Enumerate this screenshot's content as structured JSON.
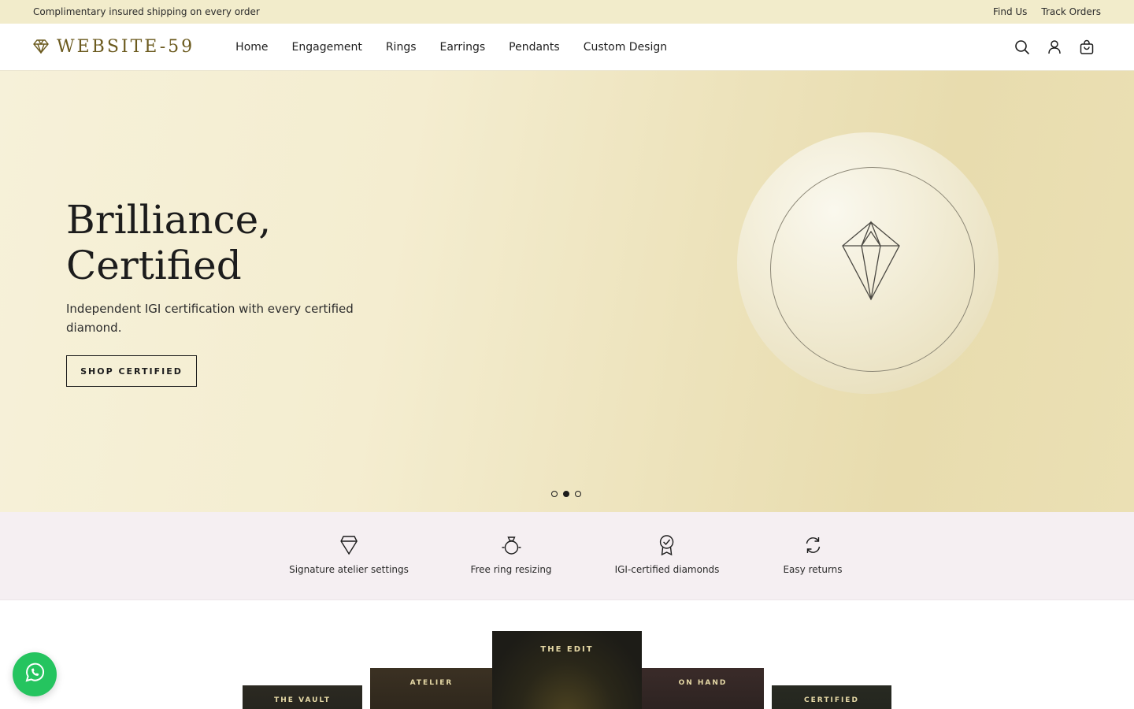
{
  "announcement": {
    "text": "Complimentary insured shipping on every order",
    "links": [
      "Find Us",
      "Track Orders"
    ]
  },
  "header": {
    "logo_text": "WEBSITE-59",
    "logo_icon": "diamond-icon",
    "nav": [
      "Home",
      "Engagement",
      "Rings",
      "Earrings",
      "Pendants",
      "Custom Design"
    ],
    "icons": [
      "search-icon",
      "account-icon",
      "cart-icon"
    ]
  },
  "hero": {
    "title_line1": "Brilliance,",
    "title_line2": "Certified",
    "subtitle": "Independent IGI certification with every certified diamond.",
    "button_label": "SHOP CERTIFIED",
    "slides_total": 3,
    "active_slide": 2
  },
  "features": [
    {
      "label": "Signature atelier settings",
      "icon": "diamond-outline-icon"
    },
    {
      "label": "Free ring resizing",
      "icon": "ring-icon"
    },
    {
      "label": "IGI-certified diamonds",
      "icon": "certified-badge-icon"
    },
    {
      "label": "Easy returns",
      "icon": "refresh-icon"
    }
  ],
  "collections": [
    "THE VAULT",
    "ATELIER",
    "THE EDIT",
    "ON HAND",
    "CERTIFIED"
  ],
  "colors": {
    "announcement_bg": "#f2eccb",
    "brand_gold": "#6b5a1e",
    "features_bg": "#f5eff2",
    "whatsapp": "#25c45f"
  },
  "whatsapp_icon": "whatsapp-icon"
}
